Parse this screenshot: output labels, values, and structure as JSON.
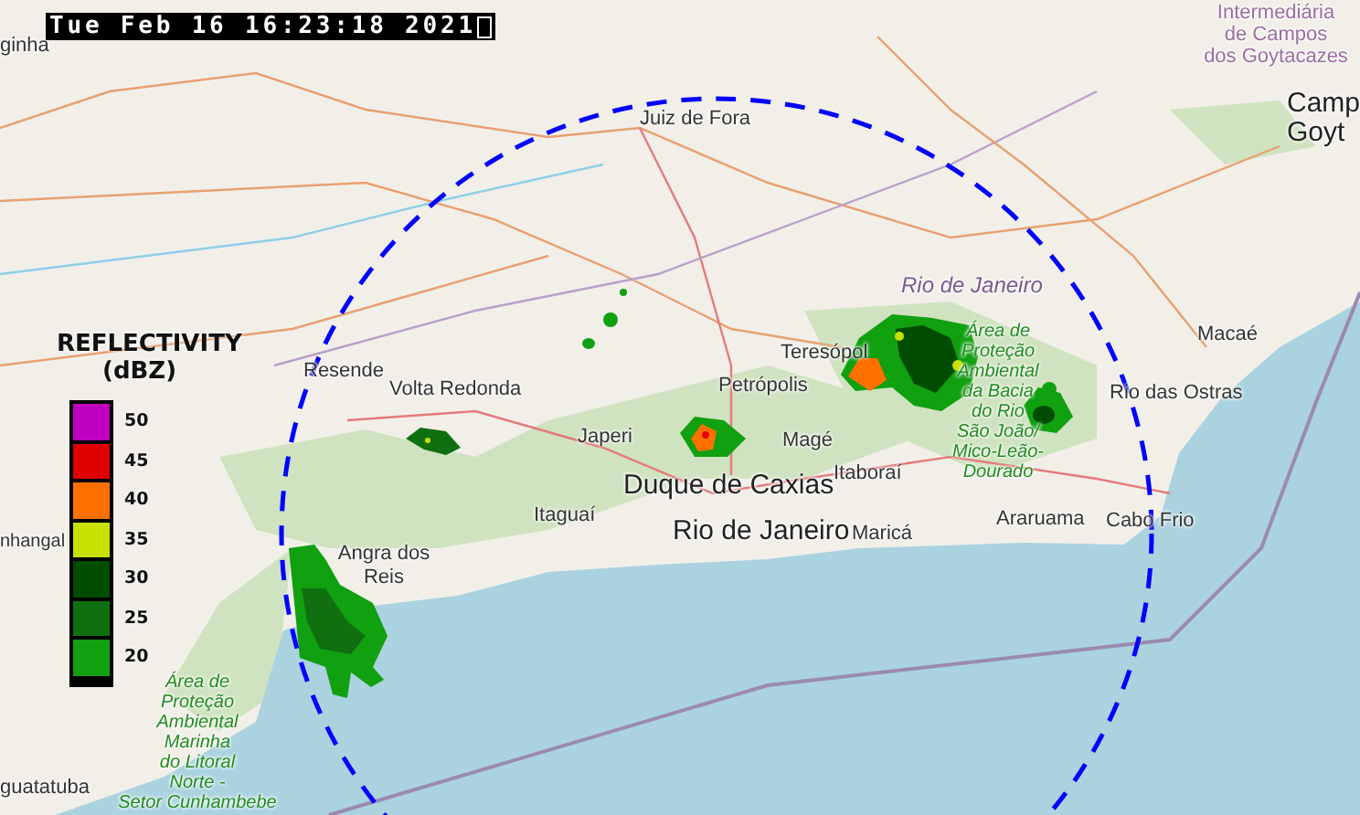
{
  "timestamp": "Tue Feb 16 16:23:18 2021",
  "legend": {
    "title": "REFLECTIVITY",
    "unit": "(dBZ)",
    "items": [
      {
        "label": "50",
        "color": "#c000c0"
      },
      {
        "label": "45",
        "color": "#e00000"
      },
      {
        "label": "40",
        "color": "#ff7000"
      },
      {
        "label": "35",
        "color": "#c8e000"
      },
      {
        "label": "30",
        "color": "#004c00"
      },
      {
        "label": "25",
        "color": "#107010"
      },
      {
        "label": "20",
        "color": "#10a010"
      }
    ]
  },
  "map_labels": [
    {
      "kind": "city",
      "lines": [
        "ginha"
      ]
    },
    {
      "kind": "region",
      "lines": [
        "Intermediária",
        "de Campos",
        "dos Goytacazes"
      ]
    },
    {
      "kind": "city",
      "lines": [
        "Juiz de Fora"
      ]
    },
    {
      "kind": "major-city",
      "lines": [
        "Camp",
        "Goyt"
      ]
    },
    {
      "kind": "state",
      "lines": [
        "Rio de Janeiro"
      ]
    },
    {
      "kind": "city",
      "lines": [
        "Resende"
      ]
    },
    {
      "kind": "city",
      "lines": [
        "Volta Redonda"
      ]
    },
    {
      "kind": "city",
      "lines": [
        "Teresópol"
      ]
    },
    {
      "kind": "city",
      "lines": [
        "Petrópolis"
      ]
    },
    {
      "kind": "protected-area",
      "lines": [
        "Área de",
        "Proteção",
        "Ambiental",
        "da Bacia",
        "do Rio",
        "São João/",
        "Mico-Leão-",
        "Dourado"
      ]
    },
    {
      "kind": "city",
      "lines": [
        "Macaé"
      ]
    },
    {
      "kind": "city",
      "lines": [
        "Rio das Ostras"
      ]
    },
    {
      "kind": "city",
      "lines": [
        "Japeri"
      ]
    },
    {
      "kind": "city",
      "lines": [
        "Magé"
      ]
    },
    {
      "kind": "major-city",
      "lines": [
        "Duque de Caxias"
      ]
    },
    {
      "kind": "city",
      "lines": [
        "Itaboraí"
      ]
    },
    {
      "kind": "city",
      "lines": [
        "Itaguaí"
      ]
    },
    {
      "kind": "major-city",
      "lines": [
        "Rio de Janeiro"
      ]
    },
    {
      "kind": "city",
      "lines": [
        "Maricá"
      ]
    },
    {
      "kind": "city",
      "lines": [
        "Araruama"
      ]
    },
    {
      "kind": "city",
      "lines": [
        "Cabo Frio"
      ]
    },
    {
      "kind": "city",
      "lines": [
        "Angra dos",
        "Reis"
      ]
    },
    {
      "kind": "city",
      "lines": [
        "nhangal"
      ]
    },
    {
      "kind": "city",
      "lines": [
        "guatatuba"
      ]
    },
    {
      "kind": "protected-area",
      "lines": [
        "Área de",
        "Proteção",
        "Ambiental",
        "Marinha",
        "do Litoral",
        "Norte -",
        "Setor Cunhambebe"
      ]
    }
  ]
}
